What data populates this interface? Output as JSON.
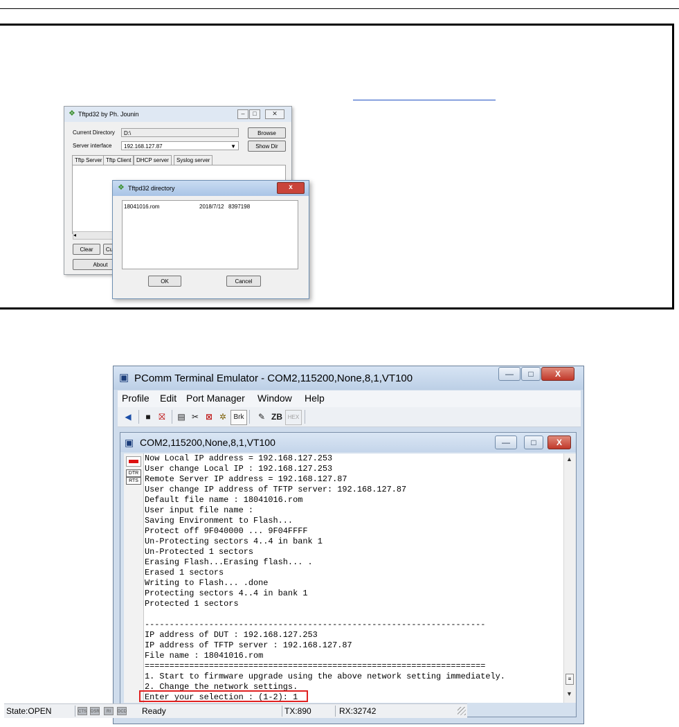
{
  "tftpd": {
    "title": "Tftpd32 by Ph. Jounin",
    "current_directory_label": "Current Directory",
    "current_directory_value": "D:\\",
    "server_interface_label": "Server interface",
    "server_interface_value": "192.168.127.87",
    "browse_label": "Browse",
    "show_dir_label": "Show Dir",
    "tabs": [
      "Tftp Server",
      "Tftp Client",
      "DHCP server",
      "Syslog server"
    ],
    "clear_label": "Clear",
    "current_label_partial": "Cu",
    "about_label": "About"
  },
  "directory_dialog": {
    "title": "Tftpd32 directory",
    "close_glyph": "x",
    "file": {
      "name": "18041016.rom",
      "date": "2018/7/12",
      "size": "8397198"
    },
    "ok_label": "OK",
    "cancel_label": "Cancel"
  },
  "pcomm": {
    "title": "PComm Terminal Emulator - COM2,115200,None,8,1,VT100",
    "menu": [
      "Profile",
      "Edit",
      "Port Manager",
      "Window",
      "Help"
    ],
    "toolbar": {
      "brk_label": "Brk",
      "zb_label": "ZB",
      "hex_label": "HEX"
    },
    "caption_buttons": {
      "minimize": "—",
      "maximize": "□",
      "close": "X"
    }
  },
  "terminal": {
    "title": "COM2,115200,None,8,1,VT100",
    "side": {
      "dtr_label": "DTR",
      "rts_label": "RTS"
    },
    "lines": [
      "Now Local IP address = 192.168.127.253",
      "User change Local IP : 192.168.127.253",
      "Remote Server IP address = 192.168.127.87",
      "User change IP address of TFTP server: 192.168.127.87",
      "Default file name : 18041016.rom",
      "User input file name :",
      "Saving Environment to Flash...",
      "Protect off 9F040000 ... 9F04FFFF",
      "Un-Protecting sectors 4..4 in bank 1",
      "Un-Protected 1 sectors",
      "Erasing Flash...Erasing flash... .",
      "Erased 1 sectors",
      "Writing to Flash... .done",
      "Protecting sectors 4..4 in bank 1",
      "Protected 1 sectors",
      "",
      "---------------------------------------------------------------------",
      "IP address of DUT : 192.168.127.253",
      "IP address of TFTP server : 192.168.127.87",
      "File name : 18041016.rom",
      "=====================================================================",
      "1. Start to firmware upgrade using the above network setting immediately.",
      "2. Change the network settings.",
      "Enter your selection : (1-2): 1"
    ]
  },
  "status": {
    "state": "State:OPEN",
    "leds": [
      "CTS",
      "DSR",
      "RI",
      "DCD"
    ],
    "ready": "Ready",
    "tx": "TX:890",
    "rx": "RX:32742"
  }
}
